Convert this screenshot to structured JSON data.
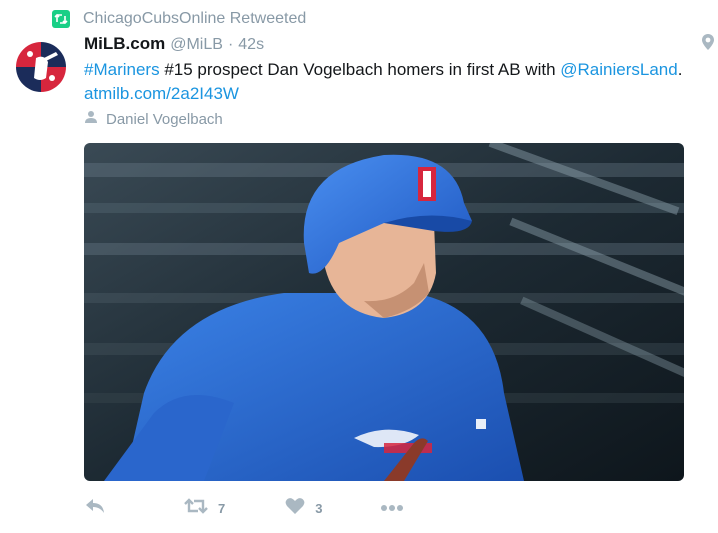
{
  "retweet_context": {
    "text": "ChicagoCubsOnline Retweeted",
    "icon": "retweet-icon"
  },
  "tweet": {
    "name": "MiLB.com",
    "handle": "@MiLB",
    "separator": "·",
    "time": "42s",
    "text_parts": {
      "hashtag": "#Mariners",
      "body": " #15 prospect Dan Vogelbach homers in first AB with ",
      "mention": "@RainiersLand",
      "end": ".",
      "url": "atmilb.com/2a2I43W"
    },
    "tagged_person": "Daniel Vogelbach",
    "media": {
      "description_icon": "baseball-batter-photo"
    }
  },
  "actions": {
    "reply": {
      "icon": "reply-icon"
    },
    "retweet": {
      "icon": "retweet-icon",
      "count": "7"
    },
    "like": {
      "icon": "heart-icon",
      "count": "3"
    },
    "more": {
      "icon": "more-icon"
    }
  },
  "colors": {
    "link": "#1b95e0",
    "muted": "#8899a6",
    "retweet_badge": "#19cf86",
    "text": "#14171a",
    "jersey_blue": "#2f6fd3"
  }
}
